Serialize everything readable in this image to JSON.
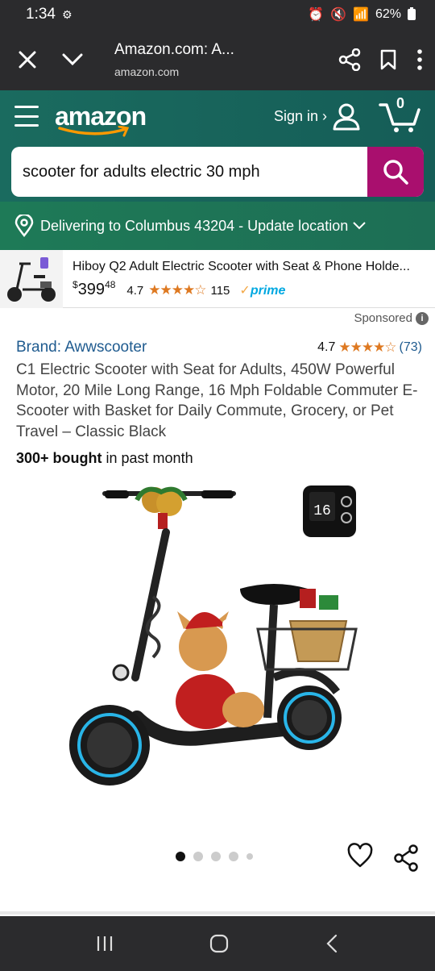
{
  "status_bar": {
    "time": "1:34",
    "battery": "62%"
  },
  "browser": {
    "page_title": "Amazon.com: A...",
    "domain": "amazon.com"
  },
  "header": {
    "logo": "amazon",
    "sign_in": "Sign in ›",
    "cart_count": "0"
  },
  "search": {
    "value": "scooter for adults electric 30 mph"
  },
  "delivery": {
    "text": "Delivering to Columbus 43204 - Update location"
  },
  "sponsored_ad": {
    "title": "Hiboy Q2 Adult Electric Scooter with Seat & Phone Holde...",
    "price_symbol": "$",
    "price_whole": "399",
    "price_fraction": "48",
    "rating": "4.7",
    "stars": "★★★★☆",
    "reviews": "115",
    "prime": "prime"
  },
  "sponsored_label": "Sponsored",
  "product": {
    "brand": "Brand: Awwscooter",
    "rating": "4.7",
    "stars": "★★★★☆",
    "reviews": "(73)",
    "title": "C1 Electric Scooter with Seat for Adults, 450W Powerful Motor, 20 Mile Long Range, 16 Mph Foldable Commuter E-Scooter with Basket for Daily Commute, Grocery, or Pet Travel – Classic Black",
    "bought_bold": "300+ bought",
    "bought_rest": " in past month",
    "display_readout": "16"
  },
  "carousel": {
    "total": 5,
    "active": 0
  },
  "colors": {
    "amazon_teal": "#14625a",
    "delivery_green": "#1f7a4c",
    "search_button": "#a90f6e",
    "star_orange": "#de7921",
    "link_blue": "#1f5b8f",
    "prime_blue": "#00a8e1"
  }
}
